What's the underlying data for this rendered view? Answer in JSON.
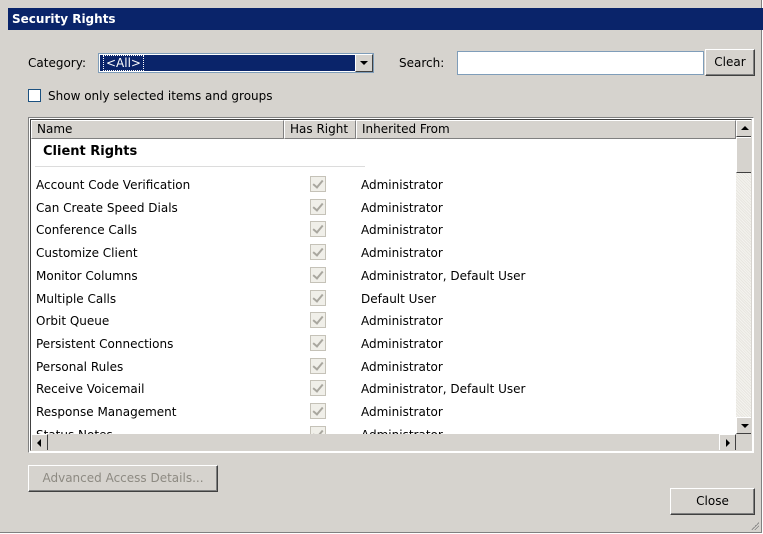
{
  "window": {
    "title": "Security Rights"
  },
  "filters": {
    "category_label": "Category:",
    "category_value": "<All>",
    "search_label": "Search:",
    "search_value": "",
    "clear_label": "Clear",
    "show_selected_label": "Show only selected items and groups",
    "show_selected_checked": false
  },
  "list": {
    "columns": [
      "Name",
      "Has Right",
      "Inherited From"
    ],
    "group": "Client Rights",
    "rows": [
      {
        "name": "Account Code Verification",
        "has_right": true,
        "from": "Administrator"
      },
      {
        "name": "Can Create Speed Dials",
        "has_right": true,
        "from": "Administrator"
      },
      {
        "name": "Conference Calls",
        "has_right": true,
        "from": "Administrator"
      },
      {
        "name": "Customize Client",
        "has_right": true,
        "from": "Administrator"
      },
      {
        "name": "Monitor Columns",
        "has_right": true,
        "from": "Administrator, Default User"
      },
      {
        "name": "Multiple Calls",
        "has_right": true,
        "from": "Default User"
      },
      {
        "name": "Orbit Queue",
        "has_right": true,
        "from": "Administrator"
      },
      {
        "name": "Persistent Connections",
        "has_right": true,
        "from": "Administrator"
      },
      {
        "name": "Personal Rules",
        "has_right": true,
        "from": "Administrator"
      },
      {
        "name": "Receive Voicemail",
        "has_right": true,
        "from": "Administrator, Default User"
      },
      {
        "name": "Response Management",
        "has_right": true,
        "from": "Administrator"
      },
      {
        "name": "Status Notes",
        "has_right": true,
        "from": "Administrator"
      }
    ]
  },
  "buttons": {
    "advanced_label": "Advanced Access Details...",
    "close_label": "Close"
  }
}
